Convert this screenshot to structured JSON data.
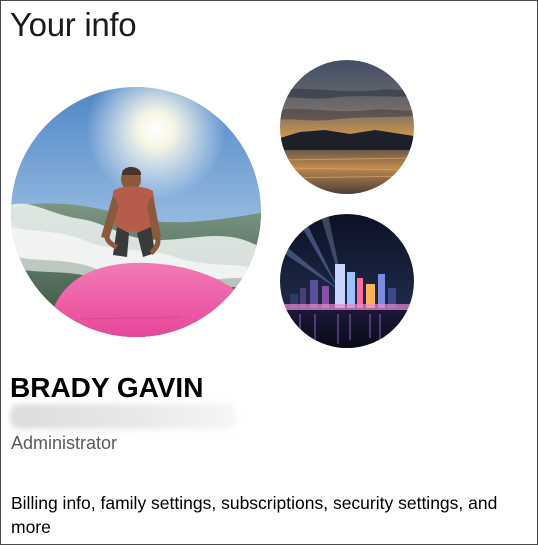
{
  "page": {
    "title": "Your info"
  },
  "user": {
    "name": "BRADY GAVIN",
    "email": "",
    "role": "Administrator"
  },
  "pictures": {
    "current": "profile-picture-surfer",
    "alternates": [
      "profile-picture-lake-sunset",
      "profile-picture-city-night"
    ]
  },
  "links": {
    "account_settings": "Billing info, family settings, subscriptions, security settings, and more"
  },
  "colors": {
    "sky_blue": "#5e93cf",
    "board_pink": "#f05aa6",
    "sunset_orange": "#e0953a",
    "night_navy": "#0d1530"
  }
}
